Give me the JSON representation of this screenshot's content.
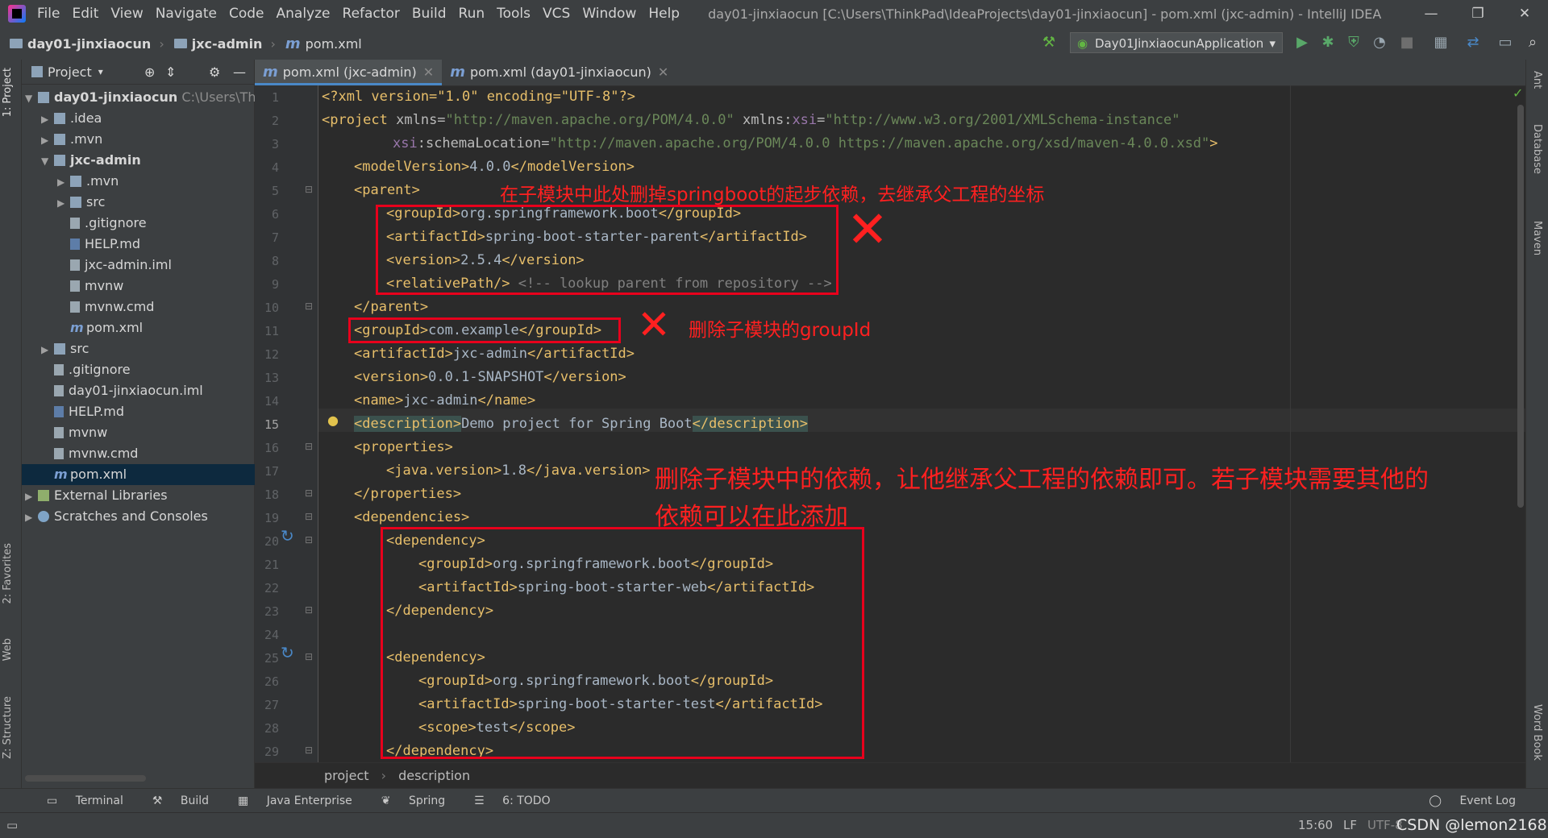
{
  "menu": [
    "File",
    "Edit",
    "View",
    "Navigate",
    "Code",
    "Analyze",
    "Refactor",
    "Build",
    "Run",
    "Tools",
    "VCS",
    "Window",
    "Help"
  ],
  "window_title": "day01-jinxiaocun [C:\\Users\\ThinkPad\\IdeaProjects\\day01-jinxiaocun] - pom.xml (jxc-admin) - IntelliJ IDEA",
  "window_controls": {
    "minimize": "—",
    "restore": "❐",
    "close": "✕"
  },
  "breadcrumb": {
    "project": "day01-jinxiaocun",
    "module": "jxc-admin",
    "file": "pom.xml"
  },
  "run_config": "Day01JinxiaocunApplication",
  "left_stripe": {
    "project": "1: Project",
    "favorites": "2: Favorites",
    "web": "Web",
    "structure": "Z: Structure"
  },
  "right_stripe": {
    "ant": "Ant",
    "database": "Database",
    "maven": "Maven",
    "wordbook": "Word Book"
  },
  "project_panel": {
    "title": "Project",
    "tree": [
      {
        "label": "day01-jinxiaocun",
        "hint": "C:\\Users\\Thin",
        "bold": true
      },
      {
        "label": ".idea"
      },
      {
        "label": ".mvn"
      },
      {
        "label": "jxc-admin",
        "bold": true
      },
      {
        "label": ".mvn"
      },
      {
        "label": "src"
      },
      {
        "label": ".gitignore"
      },
      {
        "label": "HELP.md"
      },
      {
        "label": "jxc-admin.iml"
      },
      {
        "label": "mvnw"
      },
      {
        "label": "mvnw.cmd"
      },
      {
        "label": "pom.xml"
      },
      {
        "label": "src"
      },
      {
        "label": ".gitignore"
      },
      {
        "label": "day01-jinxiaocun.iml"
      },
      {
        "label": "HELP.md"
      },
      {
        "label": "mvnw"
      },
      {
        "label": "mvnw.cmd"
      },
      {
        "label": "pom.xml"
      },
      {
        "label": "External Libraries"
      },
      {
        "label": "Scratches and Consoles"
      }
    ]
  },
  "editor_tabs": [
    {
      "label": "pom.xml (jxc-admin)",
      "active": true
    },
    {
      "label": "pom.xml (day01-jinxiaocun)",
      "active": false
    }
  ],
  "code": {
    "current_line": 15,
    "line_numbers": [
      "1",
      "2",
      "3",
      "4",
      "5",
      "6",
      "7",
      "8",
      "9",
      "10",
      "11",
      "12",
      "13",
      "14",
      "15",
      "16",
      "17",
      "18",
      "19",
      "20",
      "21",
      "22",
      "23",
      "24",
      "25",
      "26",
      "27",
      "28",
      "29"
    ],
    "line1": {
      "text": "<?xml version=\"1.0\" encoding=\"UTF-8\"?>"
    },
    "line2": {
      "open": "<project ",
      "a1": "xmlns=",
      "v1": "\"http://maven.apache.org/POM/4.0.0\"",
      "a2": " xmlns:",
      "ns": "xsi",
      "a2b": "=",
      "v2": "\"http://www.w3.org/2001/XMLSchema-instance\""
    },
    "line3": {
      "ns": "xsi",
      "a": ":schemaLocation=",
      "v": "\"http://maven.apache.org/POM/4.0.0 https://maven.apache.org/xsd/maven-4.0.0.xsd\"",
      "close": ">"
    },
    "line4": {
      "o": "<modelVersion>",
      "t": "4.0.0",
      "c": "</modelVersion>"
    },
    "line5": {
      "o": "<parent>"
    },
    "line6": {
      "o": "<groupId>",
      "t": "org.springframework.boot",
      "c": "</groupId>"
    },
    "line7": {
      "o": "<artifactId>",
      "t": "spring-boot-starter-parent",
      "c": "</artifactId>"
    },
    "line8": {
      "o": "<version>",
      "t": "2.5.4",
      "c": "</version>"
    },
    "line9": {
      "o": "<relativePath/>",
      "cm": " <!-- lookup parent from repository -->"
    },
    "line10": {
      "c": "</parent>"
    },
    "line11": {
      "o": "<groupId>",
      "t": "com.example",
      "c": "</groupId>"
    },
    "line12": {
      "o": "<artifactId>",
      "t": "jxc-admin",
      "c": "</artifactId>"
    },
    "line13": {
      "o": "<version>",
      "t": "0.0.1-SNAPSHOT",
      "c": "</version>"
    },
    "line14": {
      "o": "<name>",
      "t": "jxc-admin",
      "c": "</name>"
    },
    "line15": {
      "o": "<description>",
      "t": "Demo project for Spring Boot",
      "c": "</description>"
    },
    "line16": {
      "o": "<properties>"
    },
    "line17": {
      "o": "<java.version>",
      "t": "1.8",
      "c": "</java.version>"
    },
    "line18": {
      "c": "</properties>"
    },
    "line19": {
      "o": "<dependencies>"
    },
    "line20": {
      "o": "<dependency>"
    },
    "line21": {
      "o": "<groupId>",
      "t": "org.springframework.boot",
      "c": "</groupId>"
    },
    "line22": {
      "o": "<artifactId>",
      "t": "spring-boot-starter-web",
      "c": "</artifactId>"
    },
    "line23": {
      "c": "</dependency>"
    },
    "line25": {
      "o": "<dependency>"
    },
    "line26": {
      "o": "<groupId>",
      "t": "org.springframework.boot",
      "c": "</groupId>"
    },
    "line27": {
      "o": "<artifactId>",
      "t": "spring-boot-starter-test",
      "c": "</artifactId>"
    },
    "line28": {
      "o": "<scope>",
      "t": "test",
      "c": "</scope>"
    },
    "line29": {
      "c": "</dependency>"
    }
  },
  "annotations": {
    "note1": "在子模块中此处删掉springboot的起步依赖，去继承父工程的坐标",
    "note2": "删除子模块的groupId",
    "note3a": "删除子模块中的依赖，让他继承父工程的依赖即可。若子模块需要其他的",
    "note3b": "依赖可以在此添加",
    "cross": "✕",
    "color": "#e8001c"
  },
  "editor_breadcrumb": {
    "a": "project",
    "b": "description"
  },
  "bottom_tools": [
    "Terminal",
    "Build",
    "Java Enterprise",
    "Spring",
    "6: TODO"
  ],
  "event_log": "Event Log",
  "status": {
    "position": "15:60",
    "line_sep": "LF",
    "encoding": "UTF-8",
    "watermark": "CSDN @lemon2168"
  }
}
